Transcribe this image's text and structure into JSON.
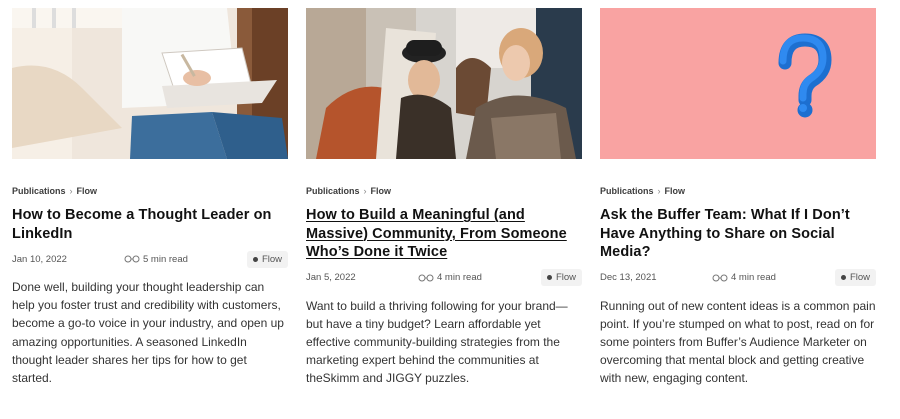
{
  "cards": [
    {
      "image_alt": "Person writing in a notebook",
      "breadcrumb": {
        "parent": "Publications",
        "child": "Flow"
      },
      "title": "How to Become a Thought Leader on LinkedIn",
      "date": "Jan 10, 2022",
      "read_time": "5 min read",
      "tag": "Flow",
      "excerpt": "Done well, building your thought leadership can help you foster trust and credibility with customers, become a go-to voice in your industry, and open up amazing opportunities. A seasoned LinkedIn thought leader shares her tips for how to get started."
    },
    {
      "image_alt": "Group of people laughing together",
      "breadcrumb": {
        "parent": "Publications",
        "child": "Flow"
      },
      "title": "How to Build a Meaningful (and Massive) Community, From Someone Who’s Done it Twice",
      "date": "Jan 5, 2022",
      "read_time": "4 min read",
      "tag": "Flow",
      "excerpt": "Want to build a thriving following for your brand—but have a tiny budget? Learn affordable yet effective community-building strategies from the marketing expert behind the communities at theSkimm and JIGGY puzzles."
    },
    {
      "image_alt": "Blue question mark on pink background",
      "breadcrumb": {
        "parent": "Publications",
        "child": "Flow"
      },
      "title": "Ask the Buffer Team: What If I Don’t Have Anything to Share on Social Media?",
      "date": "Dec 13, 2021",
      "read_time": "4 min read",
      "tag": "Flow",
      "excerpt": "Running out of new content ideas is a common pain point. If you’re stumped on what to post, read on for some pointers from Buffer’s Audience Marketer on overcoming that mental block and getting creative with new, engaging content."
    }
  ],
  "icons": {
    "read_time": "glasses-icon",
    "tag": "dot-icon",
    "breadcrumb_separator": "chevron-right-icon"
  }
}
